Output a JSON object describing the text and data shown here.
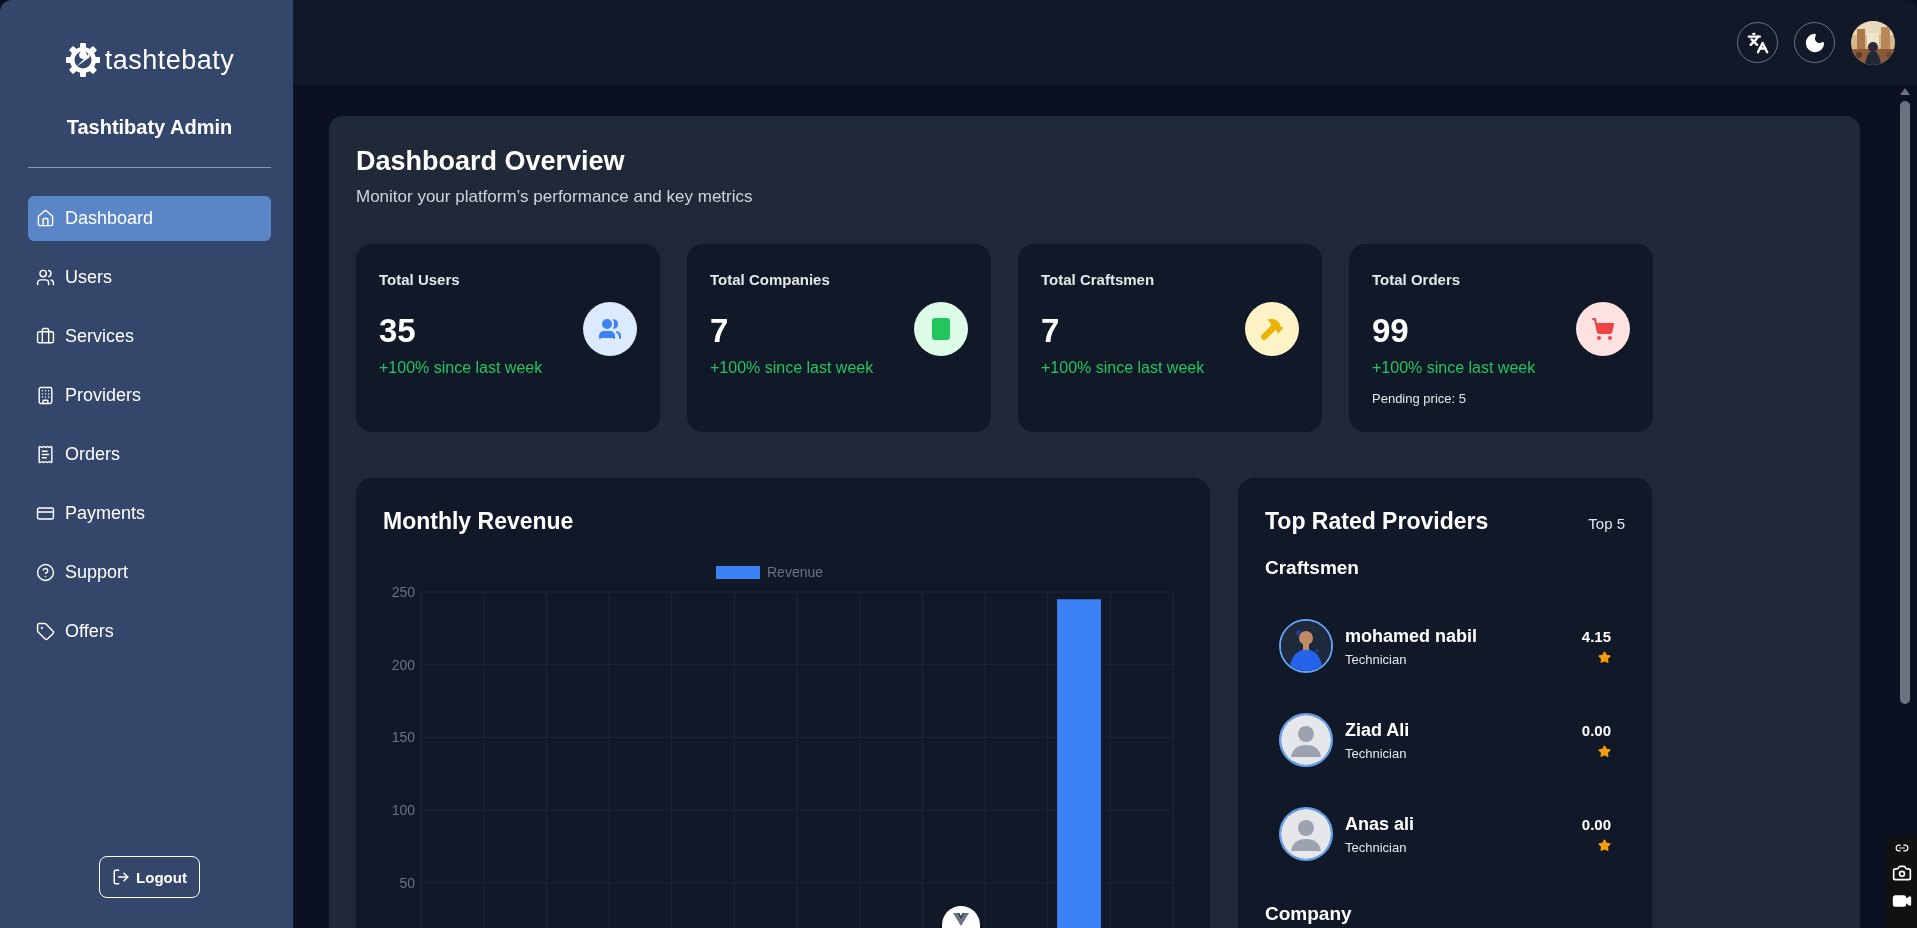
{
  "sidebar": {
    "logo": "tashtebaty",
    "title": "Tashtibaty Admin",
    "items": [
      {
        "label": "Dashboard",
        "selected": true
      },
      {
        "label": "Users",
        "selected": false
      },
      {
        "label": "Services",
        "selected": false
      },
      {
        "label": "Providers",
        "selected": false
      },
      {
        "label": "Orders",
        "selected": false
      },
      {
        "label": "Payments",
        "selected": false
      },
      {
        "label": "Support",
        "selected": false
      },
      {
        "label": "Offers",
        "selected": false
      }
    ],
    "logout": "Logout"
  },
  "overview": {
    "title": "Dashboard Overview",
    "subtitle": "Monitor your platform’s performance and key metrics"
  },
  "stats": [
    {
      "label": "Total Users",
      "value": "35",
      "change": "+100% since last week"
    },
    {
      "label": "Total Companies",
      "value": "7",
      "change": "+100% since last week"
    },
    {
      "label": "Total Craftsmen",
      "value": "7",
      "change": "+100% since last week"
    },
    {
      "label": "Total Orders",
      "value": "99",
      "change": "+100% since last week",
      "note": "Pending price: 5"
    }
  ],
  "revenue": {
    "title": "Monthly Revenue",
    "chart_data": {
      "type": "bar",
      "categories": [
        null,
        null,
        null,
        null,
        null,
        null,
        null,
        null,
        null,
        null,
        null,
        null
      ],
      "ylim": [
        0,
        250
      ],
      "grid": true,
      "yticks": [
        50,
        100,
        150,
        200,
        250
      ],
      "series": [
        {
          "name": "Revenue",
          "color": "#3b82f6",
          "values": [
            0,
            0,
            0,
            0,
            0,
            0,
            0,
            0,
            0,
            0,
            245,
            0
          ]
        }
      ]
    }
  },
  "providers": {
    "title": "Top Rated Providers",
    "badge": "Top 5",
    "sections": [
      {
        "title": "Craftsmen",
        "items": [
          {
            "name": "mohamed nabil",
            "role": "Technician",
            "rating": "4.15"
          },
          {
            "name": "Ziad Ali",
            "role": "Technician",
            "rating": "0.00",
            "kind": "placeholder"
          },
          {
            "name": "Anas ali",
            "role": "Technician",
            "rating": "0.00",
            "kind": "placeholder"
          }
        ]
      },
      {
        "title": "Company"
      }
    ]
  }
}
